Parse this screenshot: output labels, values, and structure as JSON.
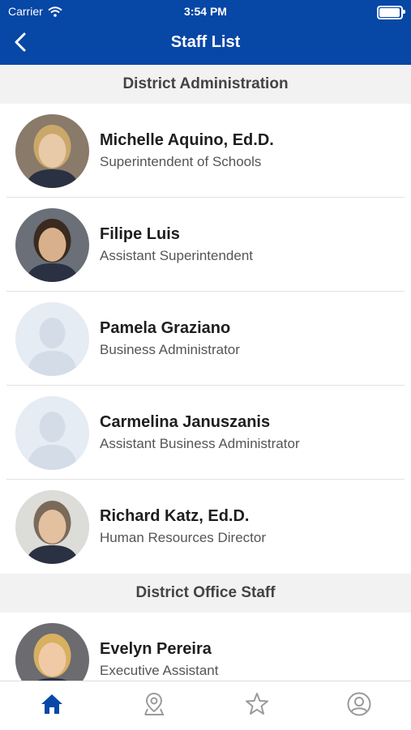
{
  "status_bar": {
    "carrier": "Carrier",
    "time": "3:54 PM"
  },
  "nav": {
    "title": "Staff List"
  },
  "sections": [
    {
      "header": "District Administration",
      "staff": [
        {
          "name": "Michelle Aquino, Ed.D.",
          "title": "Superintendent of Schools",
          "photo": "photo"
        },
        {
          "name": "Filipe Luis",
          "title": "Assistant Superintendent",
          "photo": "photo"
        },
        {
          "name": "Pamela Graziano",
          "title": "Business Administrator",
          "photo": "placeholder"
        },
        {
          "name": "Carmelina Januszanis",
          "title": "Assistant Business Administrator",
          "photo": "placeholder"
        },
        {
          "name": "Richard Katz, Ed.D.",
          "title": "Human Resources Director",
          "photo": "photo"
        }
      ]
    },
    {
      "header": "District Office Staff",
      "staff": [
        {
          "name": "Evelyn Pereira",
          "title": "Executive Assistant",
          "photo": "photo"
        }
      ]
    }
  ],
  "tabs": [
    {
      "icon": "home-icon",
      "active": true
    },
    {
      "icon": "map-pin-icon",
      "active": false
    },
    {
      "icon": "star-icon",
      "active": false
    },
    {
      "icon": "profile-icon",
      "active": false
    }
  ],
  "colors": {
    "accent": "#0747a6",
    "section_bg": "#f2f2f2",
    "inactive_icon": "#9a9a9a"
  }
}
